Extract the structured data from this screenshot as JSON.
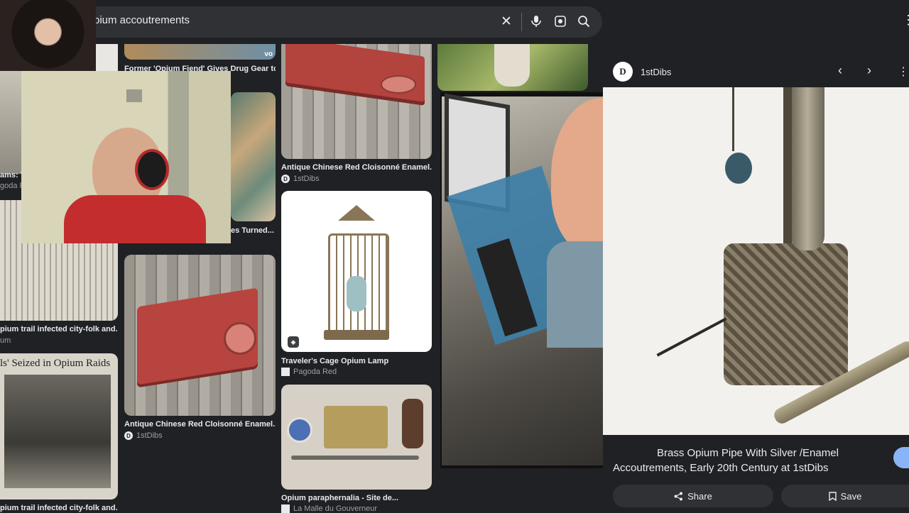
{
  "search": {
    "query": "pium accoutrements"
  },
  "results": [
    {
      "title": "Former 'Opium Fiend' Gives Drug Gear to...",
      "source": ""
    },
    {
      "title": "Antique Chinese Red Cloisonné Enamel...",
      "source": "1stDibs"
    },
    {
      "title": "ams: T",
      "source": "goda Red"
    },
    {
      "title": "es Turned...",
      "source": ""
    },
    {
      "title": "Traveler's Cage Opium Lamp",
      "source": "Pagoda Red"
    },
    {
      "title": "pium trail infected city-folk and...",
      "source": "um"
    },
    {
      "title": "Antique Chinese Red Cloisonné Enamel...",
      "source": "1stDibs"
    },
    {
      "title": "Opium paraphernalia - Site de...",
      "source": "La Malle du Gouverneur"
    },
    {
      "title": "pium trail infected city-folk and...",
      "source": ""
    }
  ],
  "newspaper_headline": "ls' Seized in Opium Raids",
  "panel": {
    "site": "1stDibs",
    "favicon_letter": "D",
    "title_line1": "Brass Opium Pipe With Silver /Enamel",
    "title_line2": "Accoutrements, Early 20th Century at 1stDibs",
    "share_label": "Share",
    "save_label": "Save"
  }
}
